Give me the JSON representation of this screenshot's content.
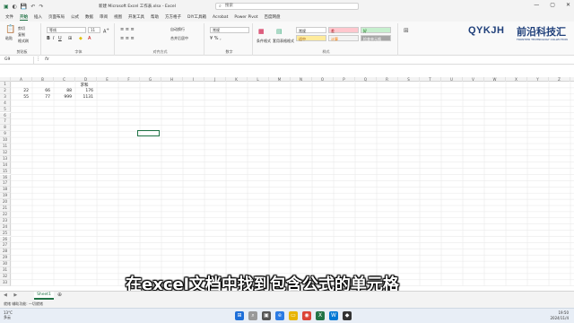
{
  "title_bar": {
    "doc_title": "新建 Microsoft Excel 工作表.xlsx  -  Excel",
    "search_placeholder": "搜索"
  },
  "ribbon_tabs": [
    "文件",
    "开始",
    "插入",
    "页面布局",
    "公式",
    "数据",
    "审阅",
    "视图",
    "开发工具",
    "帮助",
    "方方格子",
    "DIY工具箱",
    "Acrobat",
    "Power Pivot",
    "百度网盘"
  ],
  "ribbon": {
    "clipboard": {
      "cut": "剪切",
      "copy": "复制",
      "format_painter": "格式刷",
      "paste": "粘贴",
      "label": "剪贴板"
    },
    "font": {
      "font_name": "等线",
      "font_size": "11",
      "label": "字体"
    },
    "alignment": {
      "wrap": "自动换行",
      "merge": "合并后居中",
      "label": "对齐方式"
    },
    "number": {
      "format": "常规",
      "label": "数字"
    },
    "styles": {
      "cond_format": "条件格式",
      "table_format": "套用表格格式",
      "normal": "常规",
      "bad": "差",
      "good": "好",
      "neutral": "适中",
      "calc": "计算",
      "check": "检查单元格",
      "label": "样式"
    }
  },
  "logo": {
    "text_left": "QYKJH",
    "text_right": "前沿科技汇",
    "sub": "FRONTIER TECHNOLOGY COLLECTION"
  },
  "formula_bar": {
    "name_box": "G9",
    "fx": "fx"
  },
  "columns": [
    "A",
    "B",
    "C",
    "D",
    "E",
    "F",
    "G",
    "H",
    "I",
    "J",
    "K",
    "L",
    "M",
    "N",
    "O",
    "P",
    "Q",
    "R",
    "S",
    "T",
    "U",
    "V",
    "W",
    "X",
    "Y",
    "Z"
  ],
  "rows": [
    "1",
    "2",
    "3",
    "4",
    "5",
    "6",
    "7",
    "8",
    "9",
    "10",
    "11",
    "12",
    "13",
    "14",
    "15",
    "16",
    "17",
    "18",
    "19",
    "20",
    "21",
    "22",
    "23",
    "24",
    "25",
    "26",
    "27",
    "28",
    "29",
    "30",
    "31",
    "32",
    "33"
  ],
  "cells": {
    "D1": "求和",
    "A2": "22",
    "B2": "66",
    "C2": "88",
    "D2": "176",
    "A3": "55",
    "B3": "77",
    "C3": "999",
    "D3": "1131"
  },
  "sheet_tab": "Sheet1",
  "status": {
    "left": "就绪  辅助功能: 一切就绪"
  },
  "caption": "在excel文档中找到包含公式的单元格",
  "taskbar": {
    "weather_temp": "13°C",
    "weather_desc": "多云",
    "time": "19:50",
    "date": "2024/11/4"
  }
}
